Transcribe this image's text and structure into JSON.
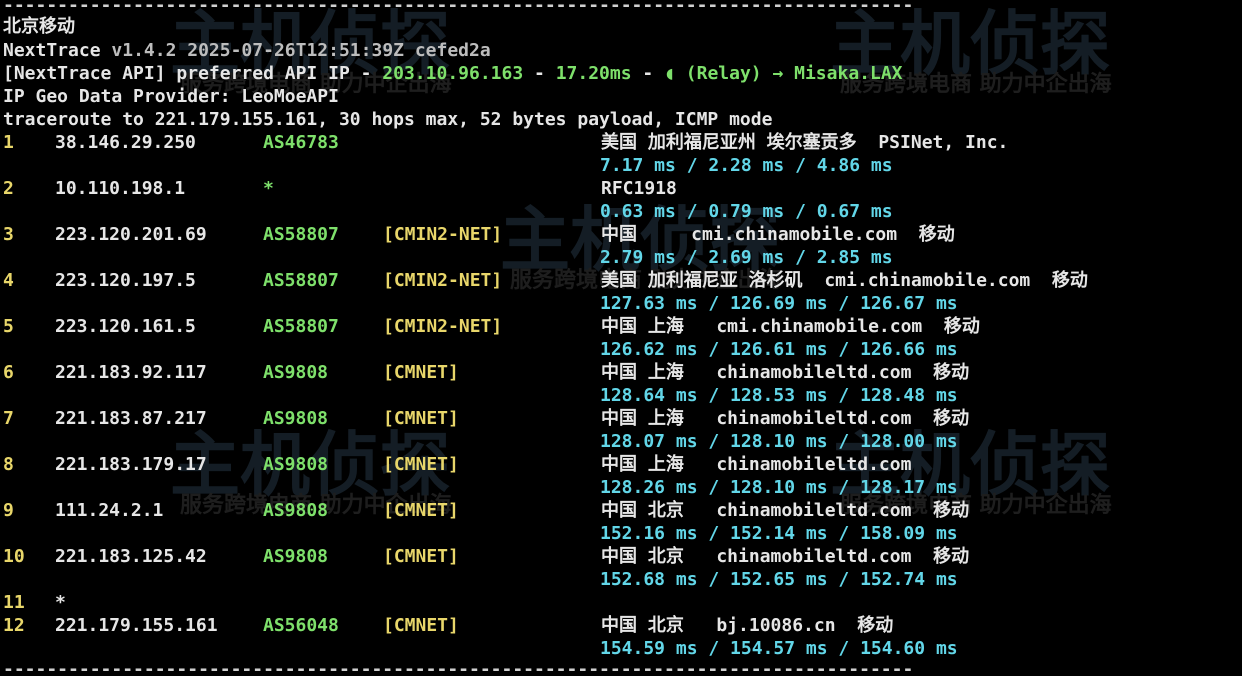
{
  "header": {
    "title": "北京移动",
    "app_name": "NextTrace",
    "version_line": "v1.4.2 2025-07-26T12:51:39Z cefed2a",
    "api_prefix": "[NextTrace API] preferred API IP - ",
    "api_ip": "203.10.96.163",
    "api_sep1": " - ",
    "api_latency": "17.20ms",
    "api_sep2": " - ",
    "api_relay": "(Relay) → Misaka.LAX",
    "geo_provider": "IP Geo Data Provider: LeoMoeAPI",
    "traceroute_line": "traceroute to 221.179.155.161, 30 hops max, 52 bytes payload, ICMP mode"
  },
  "rule_text": "----------------------------------------------------------------------------------------------------",
  "watermark": {
    "text": "主机侦探",
    "subtitle": "服务跨境电商 助力中企出海"
  },
  "hops": [
    {
      "num": "1",
      "ip": "38.146.29.250",
      "as": "AS46783",
      "net": "",
      "geo": "美国 加利福尼亚州 埃尔塞贡多  PSINet, Inc.",
      "rtt": "7.17 ms / 2.28 ms / 4.86 ms"
    },
    {
      "num": "2",
      "ip": "10.110.198.1",
      "as": "*",
      "net": "",
      "geo": "RFC1918",
      "rtt": "0.63 ms / 0.79 ms / 0.67 ms"
    },
    {
      "num": "3",
      "ip": "223.120.201.69",
      "as": "AS58807",
      "net": "[CMIN2-NET]",
      "geo": "中国     cmi.chinamobile.com  移动",
      "rtt": "2.79 ms / 2.69 ms / 2.85 ms"
    },
    {
      "num": "4",
      "ip": "223.120.197.5",
      "as": "AS58807",
      "net": "[CMIN2-NET]",
      "geo": "美国 加利福尼亚 洛杉矶  cmi.chinamobile.com  移动",
      "rtt": "127.63 ms / 126.69 ms / 126.67 ms"
    },
    {
      "num": "5",
      "ip": "223.120.161.5",
      "as": "AS58807",
      "net": "[CMIN2-NET]",
      "geo": "中国 上海   cmi.chinamobile.com  移动",
      "rtt": "126.62 ms / 126.61 ms / 126.66 ms"
    },
    {
      "num": "6",
      "ip": "221.183.92.117",
      "as": "AS9808",
      "net": "[CMNET]",
      "geo": "中国 上海   chinamobileltd.com  移动",
      "rtt": "128.64 ms / 128.53 ms / 128.48 ms"
    },
    {
      "num": "7",
      "ip": "221.183.87.217",
      "as": "AS9808",
      "net": "[CMNET]",
      "geo": "中国 上海   chinamobileltd.com  移动",
      "rtt": "128.07 ms / 128.10 ms / 128.00 ms"
    },
    {
      "num": "8",
      "ip": "221.183.179.17",
      "as": "AS9808",
      "net": "[CMNET]",
      "geo": "中国 上海   chinamobileltd.com",
      "rtt": "128.26 ms / 128.10 ms / 128.17 ms"
    },
    {
      "num": "9",
      "ip": "111.24.2.1",
      "as": "AS9808",
      "net": "[CMNET]",
      "geo": "中国 北京   chinamobileltd.com  移动",
      "rtt": "152.16 ms / 152.14 ms / 158.09 ms"
    },
    {
      "num": "10",
      "ip": "221.183.125.42",
      "as": "AS9808",
      "net": "[CMNET]",
      "geo": "中国 北京   chinamobileltd.com  移动",
      "rtt": "152.68 ms / 152.65 ms / 152.74 ms"
    },
    {
      "num": "11",
      "ip": "*",
      "as": "",
      "net": "",
      "geo": "",
      "rtt": ""
    },
    {
      "num": "12",
      "ip": "221.179.155.161",
      "as": "AS56048",
      "net": "[CMNET]",
      "geo": "中国 北京   bj.10086.cn  移动",
      "rtt": "154.59 ms / 154.57 ms / 154.60 ms"
    }
  ]
}
